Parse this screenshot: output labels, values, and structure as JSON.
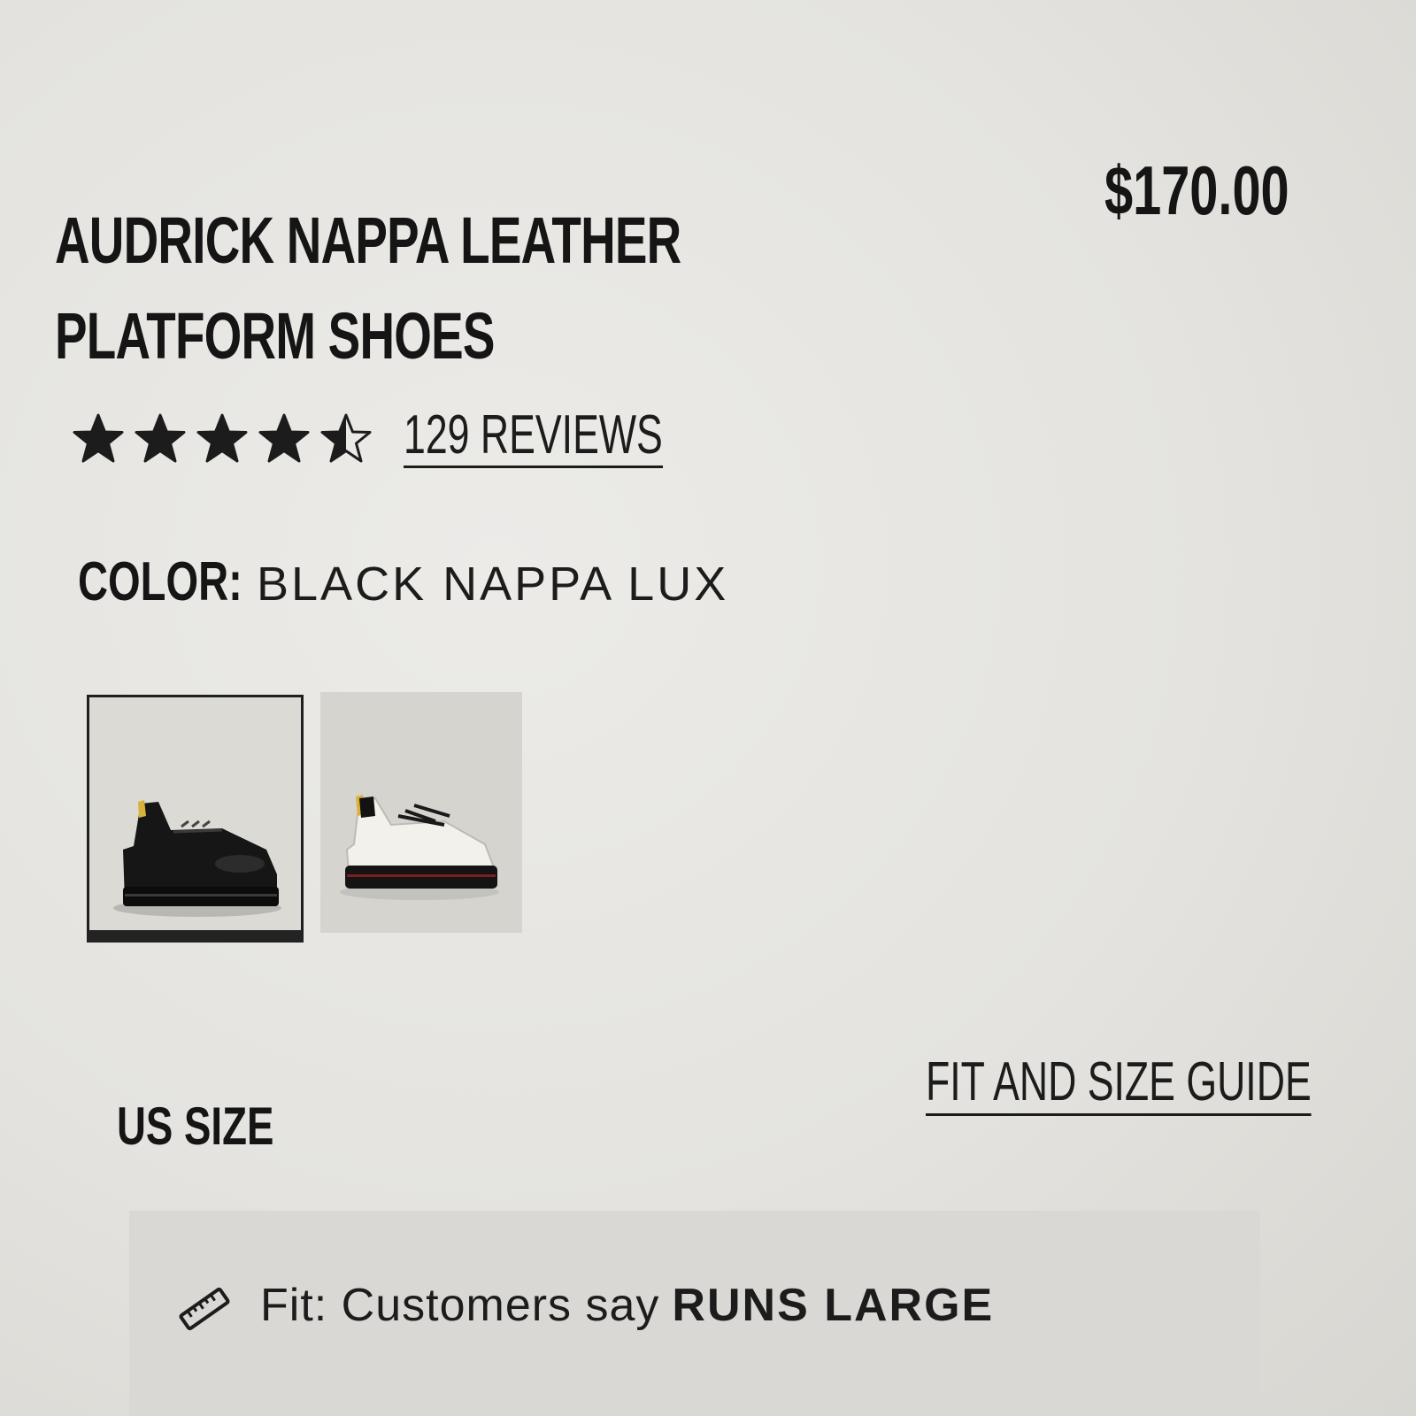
{
  "product": {
    "title_line1": "AUDRICK NAPPA LEATHER",
    "title_line2": "PLATFORM SHOES",
    "price": "$170.00"
  },
  "rating": {
    "value": 4.5,
    "max": 5,
    "reviews_link": "129 REVIEWS"
  },
  "color": {
    "label": "COLOR:",
    "value": "BLACK NAPPA LUX",
    "swatches": [
      {
        "name": "black",
        "selected": true
      },
      {
        "name": "white",
        "selected": false
      }
    ]
  },
  "size": {
    "label": "US SIZE",
    "guide_link": "FIT AND SIZE GUIDE"
  },
  "fit": {
    "icon": "ruler-icon",
    "prefix": "Fit: Customers say",
    "value": "RUNS LARGE"
  },
  "colors": {
    "text": "#1c1c1c",
    "background": "#e6e5e1",
    "fit_panel": "#d9d8d4"
  }
}
